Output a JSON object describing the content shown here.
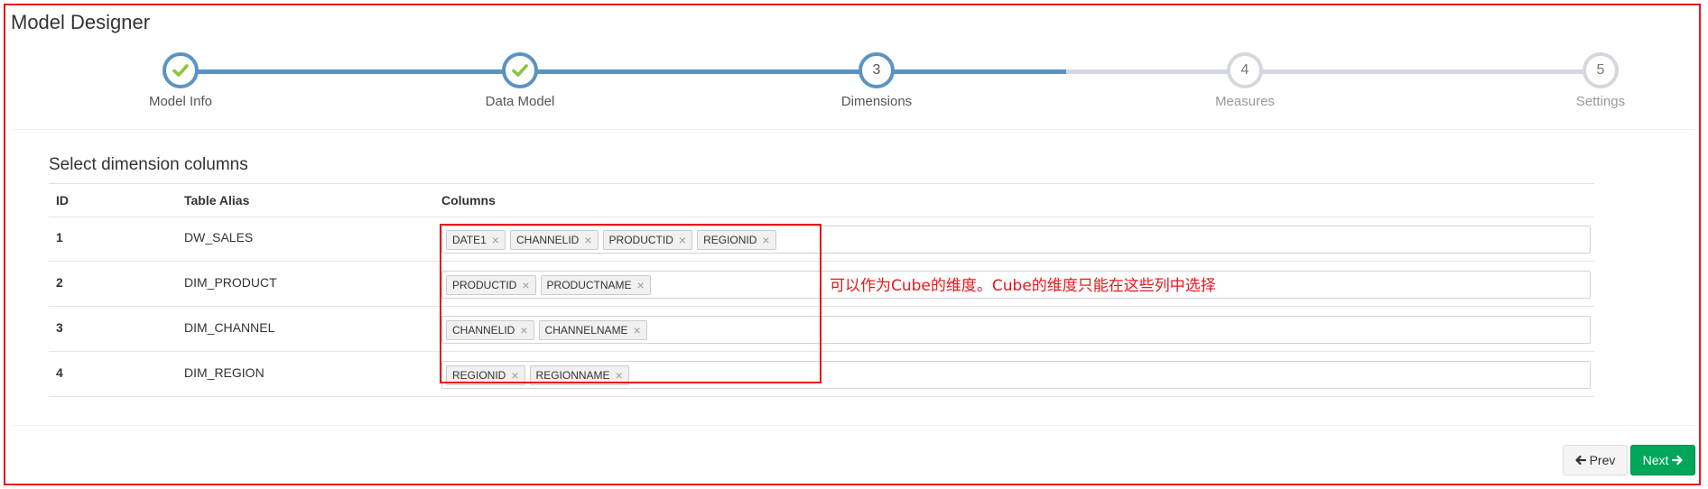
{
  "header": {
    "title": "Model Designer"
  },
  "wizard": {
    "steps": [
      {
        "label": "Model Info",
        "number": "1",
        "status": "done"
      },
      {
        "label": "Data Model",
        "number": "2",
        "status": "done"
      },
      {
        "label": "Dimensions",
        "number": "3",
        "status": "active"
      },
      {
        "label": "Measures",
        "number": "4",
        "status": "todo"
      },
      {
        "label": "Settings",
        "number": "5",
        "status": "todo"
      }
    ]
  },
  "section": {
    "title": "Select dimension columns"
  },
  "table": {
    "headers": {
      "id": "ID",
      "alias": "Table Alias",
      "columns": "Columns"
    },
    "rows": [
      {
        "id": "1",
        "alias": "DW_SALES",
        "tags": [
          "DATE1",
          "CHANNELID",
          "PRODUCTID",
          "REGIONID"
        ]
      },
      {
        "id": "2",
        "alias": "DIM_PRODUCT",
        "tags": [
          "PRODUCTID",
          "PRODUCTNAME"
        ]
      },
      {
        "id": "3",
        "alias": "DIM_CHANNEL",
        "tags": [
          "CHANNELID",
          "CHANNELNAME"
        ]
      },
      {
        "id": "4",
        "alias": "DIM_REGION",
        "tags": [
          "REGIONID",
          "REGIONNAME"
        ]
      }
    ],
    "tag_remove_glyph": "×"
  },
  "annotation": {
    "text": "可以作为Cube的维度。Cube的维度只能在这些列中选择"
  },
  "footer": {
    "prev_label": "Prev",
    "next_label": "Next"
  },
  "colors": {
    "accent": "#5b93c2",
    "success": "#00a65a",
    "check": "#8cc63f",
    "annotation": "#e8161b"
  }
}
